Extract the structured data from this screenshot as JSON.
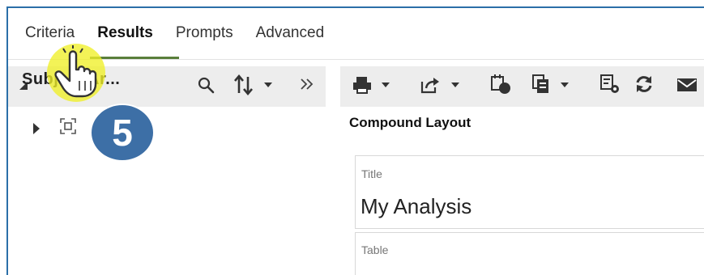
{
  "tabs": [
    {
      "label": "Criteria"
    },
    {
      "label": "Results"
    },
    {
      "label": "Prompts"
    },
    {
      "label": "Advanced"
    }
  ],
  "active_tab": "Results",
  "left_panel": {
    "title": "Subject Ar..."
  },
  "left_toolbar_icons": [
    "search-icon",
    "sort-icon",
    "expand-panel-icon"
  ],
  "right_toolbar_icons": [
    "print-icon",
    "export-icon",
    "schedule-icon",
    "copy-icon",
    "properties-icon",
    "refresh-icon",
    "email-icon"
  ],
  "compound_layout": {
    "title": "Compound Layout",
    "views": [
      {
        "label": "Title",
        "value": "My Analysis"
      },
      {
        "label": "Table",
        "value": ""
      }
    ]
  },
  "callout": {
    "step_number": "5"
  },
  "colors": {
    "accent_border": "#2b6fa8",
    "tab_underline": "#5a7f3b",
    "badge": "#3d6fa6",
    "highlight": "#f0f028"
  }
}
